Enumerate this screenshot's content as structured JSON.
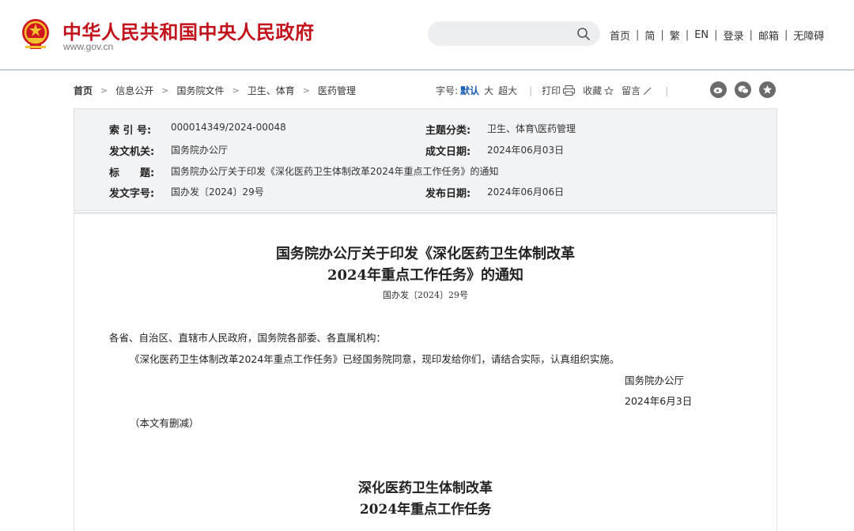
{
  "header": {
    "site_title": "中华人民共和国中央人民政府",
    "site_url": "www.gov.cn",
    "search_placeholder": "",
    "links": [
      "首页",
      "简",
      "繁",
      "EN",
      "登录",
      "邮箱",
      "无障碍"
    ]
  },
  "breadcrumb": [
    "首页",
    "信息公开",
    "国务院文件",
    "卫生、体育",
    "医药管理"
  ],
  "tools": {
    "font_label": "字号:",
    "size_default": "默认",
    "size_large": "大",
    "size_xlarge": "超大",
    "print": "打印",
    "favorite": "收藏",
    "comment": "留言",
    "social_icons": [
      "weibo-icon",
      "wechat-icon",
      "favorite-star-icon"
    ]
  },
  "info": {
    "index_label": "索 引 号:",
    "index_value": "000014349/2024-00048",
    "category_label": "主题分类:",
    "category_value": "卫生、体育\\医药管理",
    "issuer_label": "发文机关:",
    "issuer_value": "国务院办公厅",
    "created_label": "成文日期:",
    "created_value": "2024年06月03日",
    "title_label": "标　　题:",
    "title_value": "国务院办公厅关于印发《深化医药卫生体制改革2024年重点工作任务》的通知",
    "docno_label": "发文字号:",
    "docno_value": "国办发〔2024〕29号",
    "published_label": "发布日期:",
    "published_value": "2024年06月06日"
  },
  "article": {
    "title_line1": "国务院办公厅关于印发《深化医药卫生体制改革",
    "title_line2": "2024年重点工作任务》的通知",
    "doc_number": "国办发〔2024〕29号",
    "salutation": "各省、自治区、直辖市人民政府，国务院各部委、各直属机构：",
    "body": "《深化医药卫生体制改革2024年重点工作任务》已经国务院同意，现印发给你们，请结合实际，认真组织实施。",
    "signature": "国务院办公厅",
    "date": "2024年6月3日",
    "note": "（本文有删减）",
    "sub_title_line1": "深化医药卫生体制改革",
    "sub_title_line2": "2024年重点工作任务"
  },
  "colors": {
    "brand_red": "#c2131c",
    "link_blue": "#1a5bb3",
    "info_bg": "#f2f3f5"
  }
}
